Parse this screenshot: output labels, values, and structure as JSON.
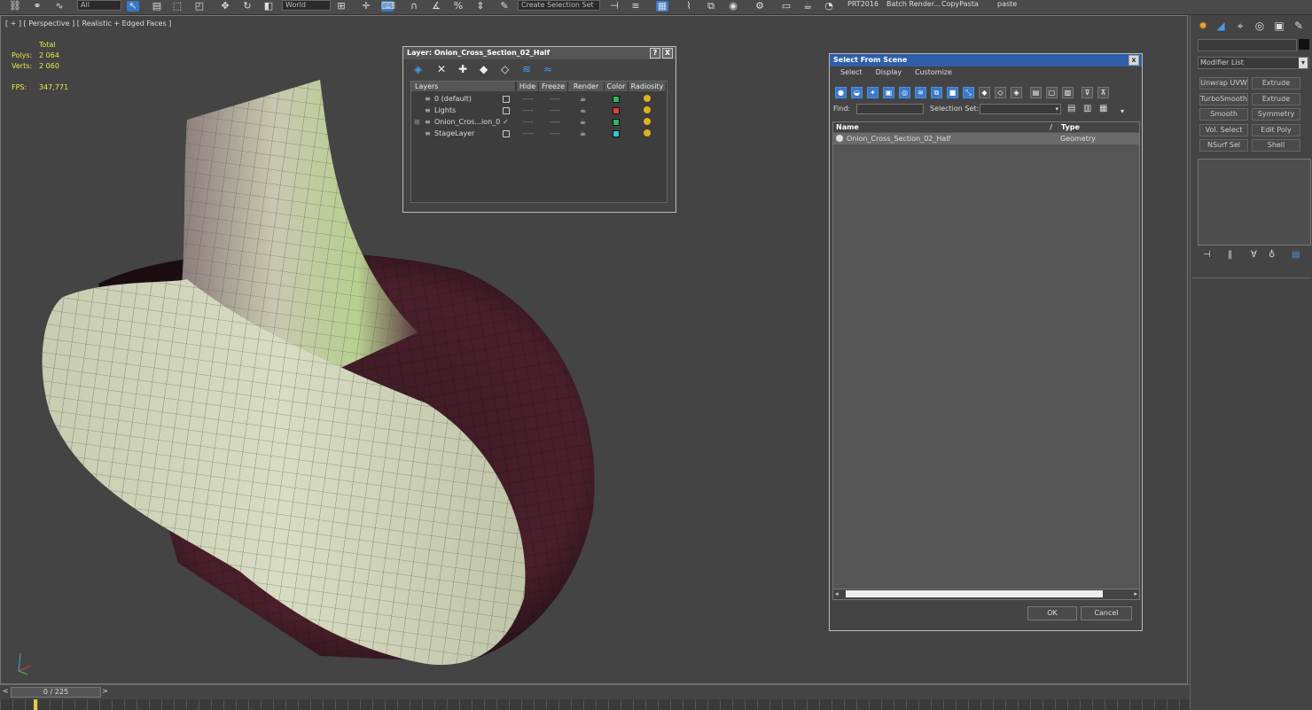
{
  "topbar": {
    "ref_coord": "World",
    "selection_set": "Create Selection Set",
    "scripts": [
      "PRT2016",
      "Batch Render...",
      "CopyPasta",
      "paste"
    ]
  },
  "viewport": {
    "label": "[ + ] [ Perspective ] [ Realistic + Edged Faces ]",
    "stats": {
      "header": "Total",
      "polys_label": "Polys:",
      "polys_value": "2 064",
      "verts_label": "Verts:",
      "verts_value": "2 060",
      "fps_label": "FPS:",
      "fps_value": "347,771"
    }
  },
  "layer_dialog": {
    "title": "Layer: Onion_Cross_Section_02_Half",
    "help": "?",
    "close": "X",
    "columns": [
      "Layers",
      "Hide",
      "Freeze",
      "Render",
      "Color",
      "Radiosity"
    ],
    "rows": [
      {
        "name": "0 (default)",
        "color": "#2db85c",
        "checked": false
      },
      {
        "name": "Lights",
        "color": "#e04040",
        "checked": false
      },
      {
        "name": "Onion_Cros...ion_0",
        "color": "#2db85c",
        "checked": true
      },
      {
        "name": "StageLayer",
        "color": "#30c8d0",
        "checked": false
      }
    ],
    "dots": "----"
  },
  "select_from_scene": {
    "title": "Select From Scene",
    "close": "x",
    "menu": [
      "Select",
      "Display",
      "Customize"
    ],
    "find_label": "Find:",
    "find_value": "",
    "selection_set_label": "Selection Set:",
    "selection_set_value": "",
    "col_name": "Name",
    "col_type": "Type",
    "sort_indicator": "/",
    "items": [
      {
        "name": "Onion_Cross_Section_02_Half",
        "type": "Geometry"
      }
    ],
    "ok": "OK",
    "cancel": "Cancel"
  },
  "command_panel": {
    "modifier_list": "Modifier List",
    "buttons": [
      [
        "Unwrap UVW",
        "Extrude"
      ],
      [
        "TurboSmooth",
        "Extrude"
      ],
      [
        "Smooth",
        "Symmetry"
      ],
      [
        "Vol. Select",
        "Edit Poly"
      ],
      [
        "NSurf Sel",
        "Shell"
      ]
    ]
  },
  "timeline": {
    "frame": "0 / 225",
    "prev": "<",
    "next": ">"
  },
  "colors": {
    "accent": "#3a78c8",
    "title_blue": "#2f5fa8",
    "stats_yellow": "#e8e84a"
  }
}
